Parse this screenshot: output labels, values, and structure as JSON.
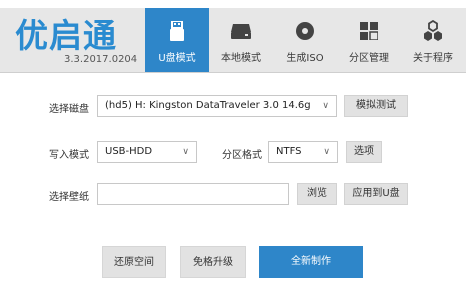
{
  "app": {
    "logo_text": "优启通",
    "version": "3.3.2017.0204"
  },
  "tabs": [
    {
      "label": "U盘模式",
      "icon": "usb-drive-icon",
      "active": true
    },
    {
      "label": "本地模式",
      "icon": "hard-drive-icon",
      "active": false
    },
    {
      "label": "生成ISO",
      "icon": "disc-icon",
      "active": false
    },
    {
      "label": "分区管理",
      "icon": "partition-grid-icon",
      "active": false
    },
    {
      "label": "关于程序",
      "icon": "hexagon-cluster-icon",
      "active": false
    }
  ],
  "form": {
    "disk_label": "选择磁盘",
    "disk_value": "(hd5) H: Kingston DataTraveler 3.0 14.6g",
    "simulate_button": "模拟测试",
    "write_mode_label": "写入模式",
    "write_mode_value": "USB-HDD",
    "partition_format_label": "分区格式",
    "partition_format_value": "NTFS",
    "options_button": "选项",
    "wallpaper_label": "选择壁纸",
    "wallpaper_value": "",
    "browse_button": "浏览",
    "apply_to_usb_button": "应用到U盘"
  },
  "actions": {
    "restore_space": "还原空间",
    "upgrade": "免格升级",
    "new_build": "全新制作"
  },
  "colors": {
    "accent": "#2e86c9",
    "logo": "#2a8bd0",
    "header_bg": "#e7e7e7"
  }
}
